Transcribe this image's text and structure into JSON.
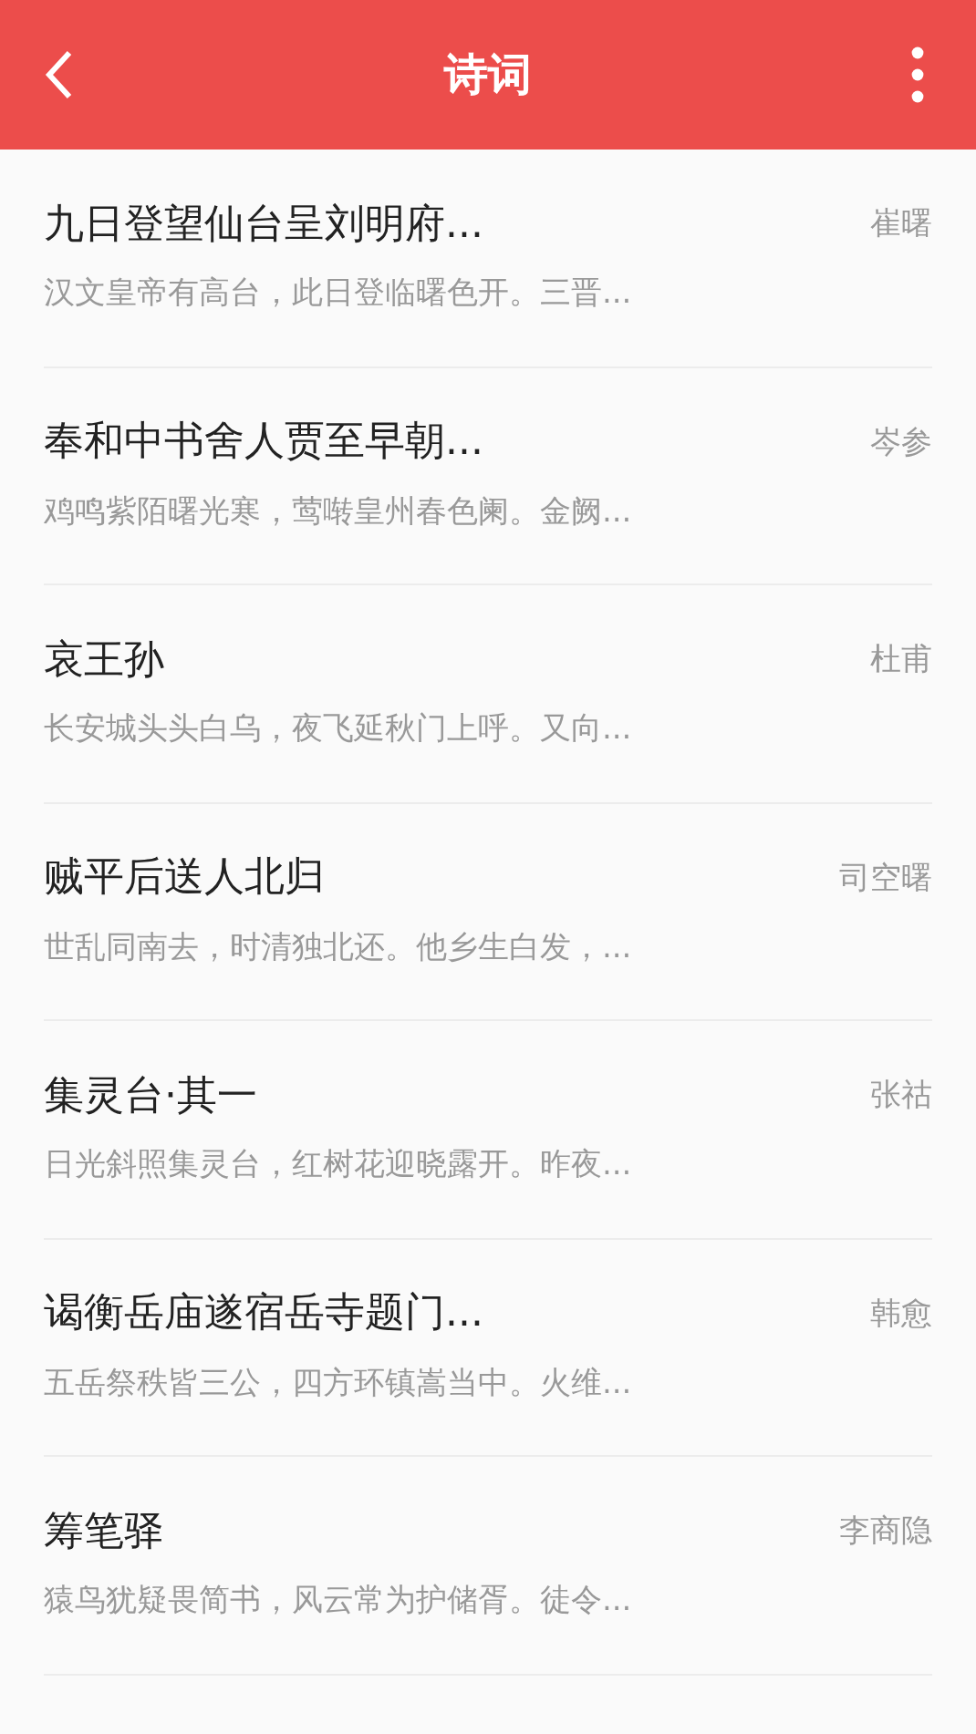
{
  "app_bar": {
    "title": "诗词"
  },
  "poems": [
    {
      "title": "九日登望仙台呈刘明府...",
      "author": "崔曙",
      "excerpt": "汉文皇帝有高台，此日登临曙色开。三晋..."
    },
    {
      "title": "奉和中书舍人贾至早朝...",
      "author": "岑参",
      "excerpt": "鸡鸣紫陌曙光寒，莺啭皇州春色阑。金阙..."
    },
    {
      "title": "哀王孙",
      "author": "杜甫",
      "excerpt": "长安城头头白乌，夜飞延秋门上呼。又向..."
    },
    {
      "title": "贼平后送人北归",
      "author": "司空曙",
      "excerpt": "世乱同南去，时清独北还。他乡生白发，..."
    },
    {
      "title": "集灵台·其一",
      "author": "张祜",
      "excerpt": "日光斜照集灵台，红树花迎晓露开。昨夜..."
    },
    {
      "title": "谒衡岳庙遂宿岳寺题门...",
      "author": "韩愈",
      "excerpt": "五岳祭秩皆三公，四方环镇嵩当中。火维..."
    },
    {
      "title": "筹笔驿",
      "author": "李商隐",
      "excerpt": "猿鸟犹疑畏简书，风云常为护储胥。徒令..."
    }
  ]
}
